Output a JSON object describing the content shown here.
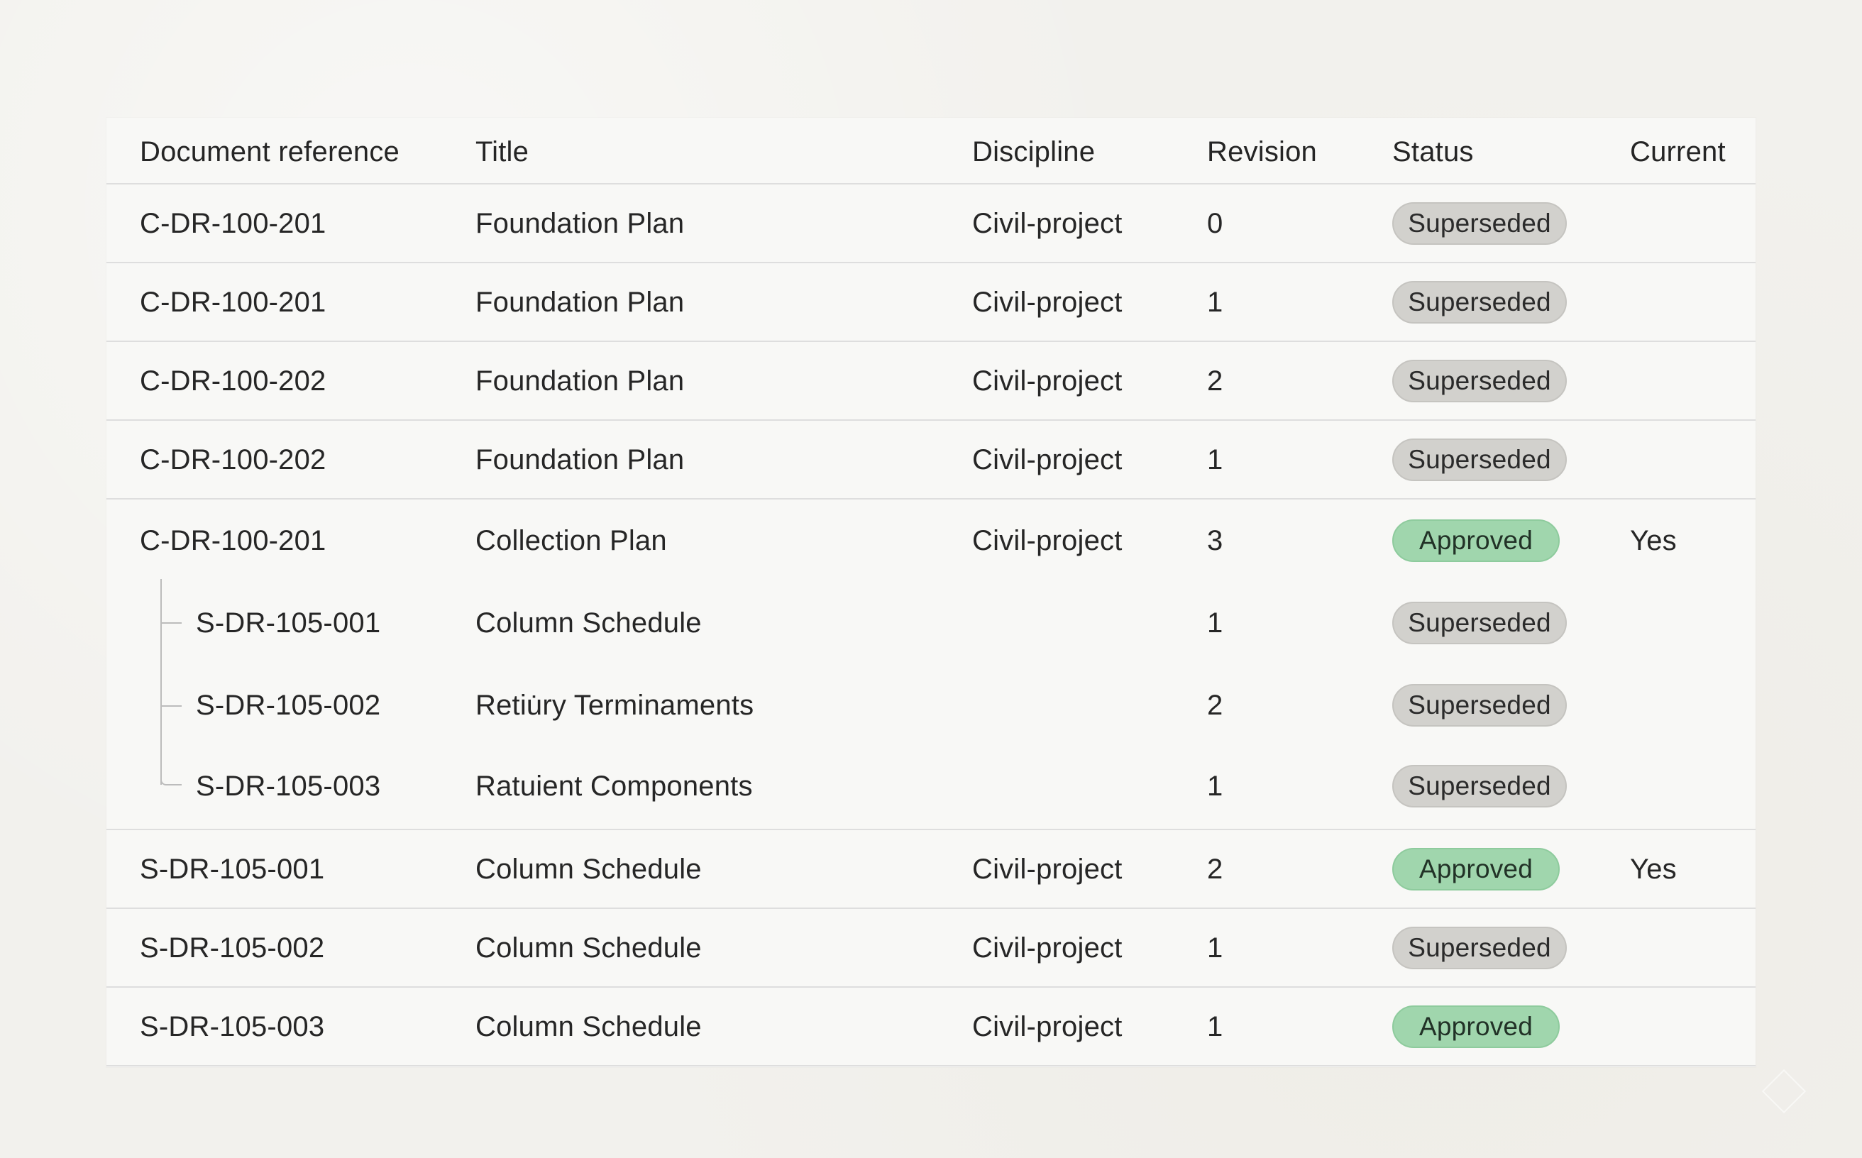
{
  "columns": {
    "ref": "Document reference",
    "title": "Title",
    "discipline": "Discipline",
    "revision": "Revision",
    "status": "Status",
    "current": "Current"
  },
  "rows": [
    {
      "ref": "C-DR-100-201",
      "title": "Foundation Plan",
      "discipline": "Civil-project",
      "revision": "0",
      "status": "Superseded",
      "current": ""
    },
    {
      "ref": "C-DR-100-201",
      "title": "Foundation Plan",
      "discipline": "Civil-project",
      "revision": "1",
      "status": "Superseded",
      "current": ""
    },
    {
      "ref": "C-DR-100-202",
      "title": "Foundation Plan",
      "discipline": "Civil-project",
      "revision": "2",
      "status": "Superseded",
      "current": ""
    },
    {
      "ref": "C-DR-100-202",
      "title": "Foundation Plan",
      "discipline": "Civil-project",
      "revision": "1",
      "status": "Superseded",
      "current": ""
    }
  ],
  "group": {
    "parent": {
      "ref": "C-DR-100-201",
      "title": "Collection Plan",
      "discipline": "Civil-project",
      "revision": "3",
      "status": "Approved",
      "current": "Yes"
    },
    "children": [
      {
        "ref": "S-DR-105-001",
        "title": "Column Schedule",
        "revision": "1",
        "status": "Superseded"
      },
      {
        "ref": "S-DR-105-002",
        "title": "Retiu̇ry Terminaments",
        "revision": "2",
        "status": "Superseded"
      },
      {
        "ref": "S-DR-105-003",
        "title": "Ratuient Components",
        "revision": "1",
        "status": "Superseded"
      }
    ]
  },
  "bottom_rows": [
    {
      "ref": "S-DR-105-001",
      "title": "Column Schedule",
      "discipline": "Civil-project",
      "revision": "2",
      "status": "Approved",
      "current": "Yes"
    },
    {
      "ref": "S-DR-105-002",
      "title": "Column Schedule",
      "discipline": "Civil-project",
      "revision": "1",
      "status": "Superseded",
      "current": ""
    },
    {
      "ref": "S-DR-105-003",
      "title": "Column Schedule",
      "discipline": "Civil-project",
      "revision": "1",
      "status": "Approved",
      "current": ""
    }
  ],
  "colors": {
    "background": "#f2f1ed",
    "table": "#f8f8f6",
    "superseded_badge": "#d2d1cd",
    "approved_badge": "#a0d6ad",
    "divider": "#dedede"
  }
}
